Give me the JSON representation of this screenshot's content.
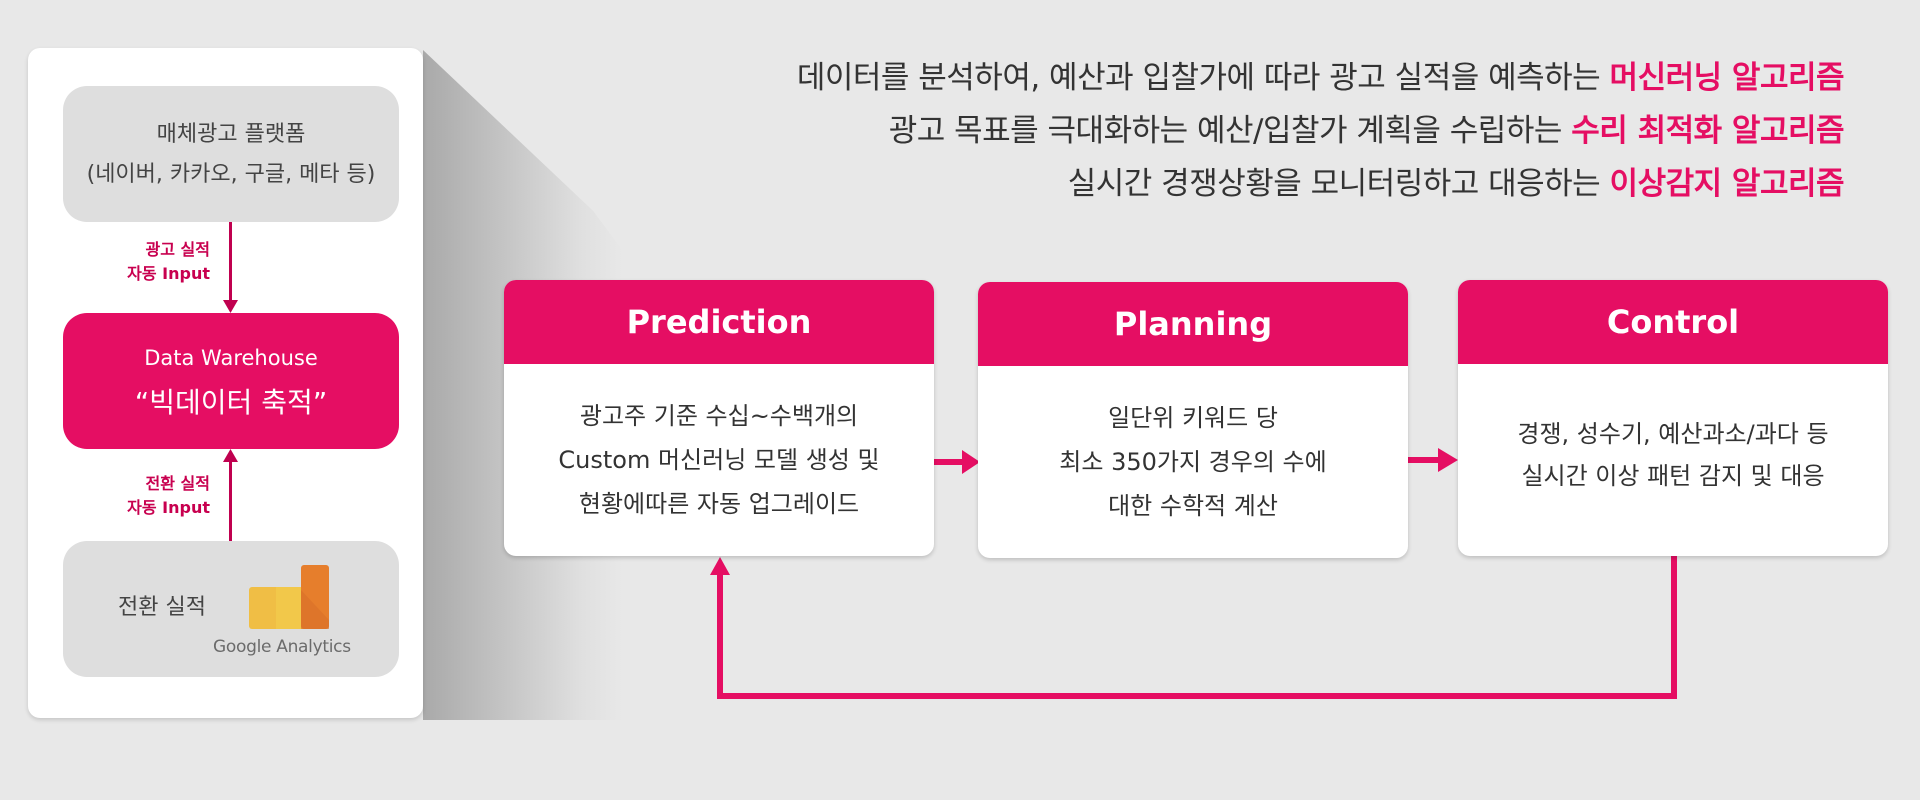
{
  "headline": [
    {
      "text": "데이터를 분석하여, 예산과 입찰가에 따라 광고 실적을 예측하는 ",
      "highlight": "머신러닝 알고리즘"
    },
    {
      "text": "광고 목표를 극대화하는 예산/입찰가 계획을 수립하는 ",
      "highlight": "수리 최적화 알고리즘"
    },
    {
      "text": "실시간 경쟁상황을 모니터링하고 대응하는 ",
      "highlight": "이상감지 알고리즘"
    }
  ],
  "left_panel": {
    "platforms": {
      "line1": "매체광고 플랫폼",
      "line2": "(네이버, 카카오, 구글, 메타 등)"
    },
    "ad_input_label": {
      "line1": "광고 실적",
      "line2": "자동 Input"
    },
    "data_warehouse": {
      "line1": "Data Warehouse",
      "line2": "“빅데이터 축적”"
    },
    "conversion_input_label": {
      "line1": "전환 실적",
      "line2": "자동 Input"
    },
    "conversion": {
      "label": "전환 실적",
      "logo_text": "Google Analytics",
      "logo_icon": "google-analytics-icon"
    }
  },
  "cards": [
    {
      "title": "Prediction",
      "lines": [
        "광고주 기준 수십~수백개의",
        "Custom 머신러닝 모델 생성 및",
        "현황에따른 자동 업그레이드"
      ]
    },
    {
      "title": "Planning",
      "lines": [
        "일단위 키워드 당",
        "최소 350가지 경우의 수에",
        "대한 수학적 계산"
      ]
    },
    {
      "title": "Control",
      "lines": [
        "경쟁, 성수기, 예산과소/과다 등",
        "실시간 이상 패턴 감지 및 대응"
      ]
    }
  ],
  "colors": {
    "accent": "#e50e63",
    "accent_dark": "#c8004f",
    "background": "#e8e8e8",
    "box_gray": "#dedede",
    "text": "#333333"
  }
}
